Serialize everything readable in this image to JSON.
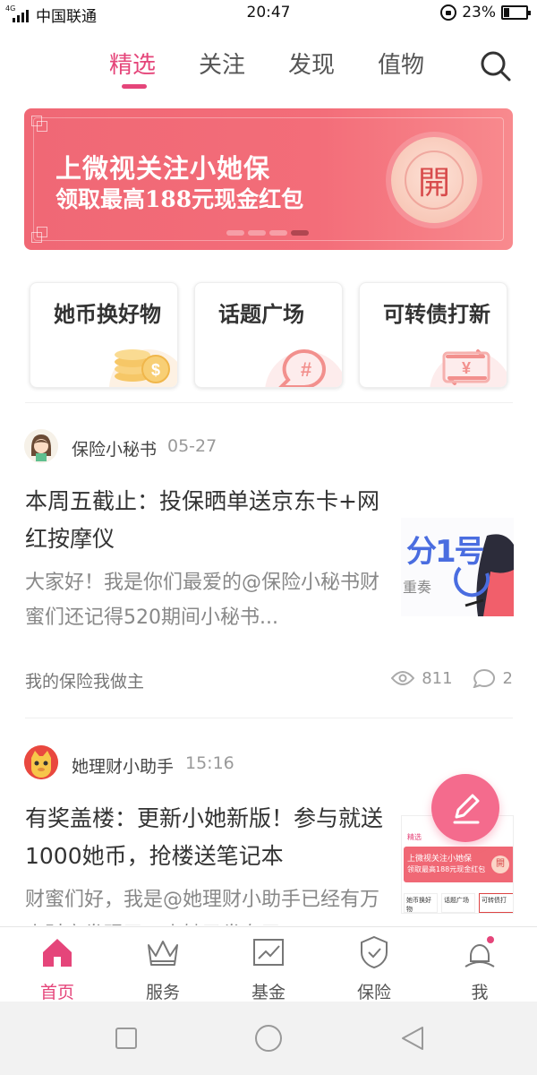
{
  "status_bar": {
    "carrier": "中国联通",
    "network": "4G",
    "time": "20:47",
    "battery": "23%",
    "battery_level": 0.23
  },
  "top_tabs": [
    {
      "label": "精选",
      "active": true
    },
    {
      "label": "关注",
      "active": false
    },
    {
      "label": "发现",
      "active": false
    },
    {
      "label": "值物",
      "active": false
    }
  ],
  "banner": {
    "line1": "上微视关注小她保",
    "line2": "领取最高188元现金红包",
    "seal_char": "開",
    "page_count": 4,
    "active_page": 4
  },
  "shortcuts": [
    {
      "label": "她币换好物",
      "icon": "coins-icon"
    },
    {
      "label": "话题广场",
      "icon": "hashtag-bubble-icon"
    },
    {
      "label": "可转债打新",
      "icon": "yen-exchange-icon"
    }
  ],
  "posts": [
    {
      "author": "保险小秘书",
      "time": "05-27",
      "title": "本周五截止：投保晒单送京东卡+网红按摩仪",
      "body": "大家好！我是你们最爱的@保险小秘书财蜜们还记得520期间小秘书...",
      "thumb_text": "分1号",
      "thumb_sub": "重奏",
      "tag": "我的保险我做主",
      "views": "811",
      "comments": "2"
    },
    {
      "author": "她理财小助手",
      "time": "15:16",
      "title": "有奖盖楼：更新小她新版！参与就送1000她币，抢楼送笔记本",
      "body": "财蜜们好，我是@她理财小助手已经有万小财蜜发现了，小她又发布了...",
      "thumb_lines": [
        "精选",
        "上微视关注小她保",
        "领取最高188元现金红包",
        "她币换好物",
        "话题广场",
        "可转债打",
        "開"
      ]
    }
  ],
  "bottom_nav": [
    {
      "label": "首页",
      "icon": "home-icon",
      "active": true
    },
    {
      "label": "服务",
      "icon": "crown-icon",
      "active": false
    },
    {
      "label": "基金",
      "icon": "chart-icon",
      "active": false
    },
    {
      "label": "保险",
      "icon": "shield-icon",
      "active": false
    },
    {
      "label": "我",
      "icon": "profile-icon",
      "active": false,
      "badge": true
    }
  ],
  "colors": {
    "accent": "#e5457a",
    "banner": "#f06875",
    "fab": "#f46b8d"
  }
}
